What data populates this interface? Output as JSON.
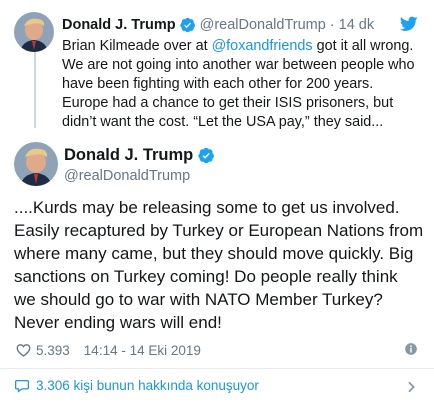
{
  "parent_tweet": {
    "author_name": "Donald J. Trump",
    "handle": "@realDonaldTrump",
    "separator": "·",
    "time": "14 dk",
    "text_before_mention": "Brian Kilmeade over at ",
    "mention": "@foxandfriends",
    "text_after_mention": " got it all wrong. We are not going into another war between people who have been fighting with each other for 200 years. Europe had a chance to get their ISIS prisoners, but didn’t want the cost. “Let the USA pay,” they said..."
  },
  "main_tweet": {
    "author_name": "Donald J. Trump",
    "handle": "@realDonaldTrump",
    "text": "....Kurds may be releasing some to get us involved. Easily recaptured by Turkey or European Nations from where many came, but they should move quickly. Big sanctions on Turkey coming! Do people really think we should go to war with NATO Member Turkey? Never ending wars will end!",
    "likes": "5.393",
    "timestamp": "14:14 - 14 Eki 2019"
  },
  "conversation": {
    "label": "3.306 kişi bunun hakkında konuşuyor"
  },
  "icons": {
    "verified": "verified-badge-icon",
    "brand": "twitter-bird-icon",
    "like": "heart-icon",
    "info": "info-icon",
    "conversation": "speech-bubble-icon",
    "expand": "chevron-right-icon"
  },
  "colors": {
    "accent": "#1da1f2",
    "link": "#1b95e0",
    "text": "#14171a",
    "secondary": "#657786",
    "divider": "#e6ecf0"
  }
}
